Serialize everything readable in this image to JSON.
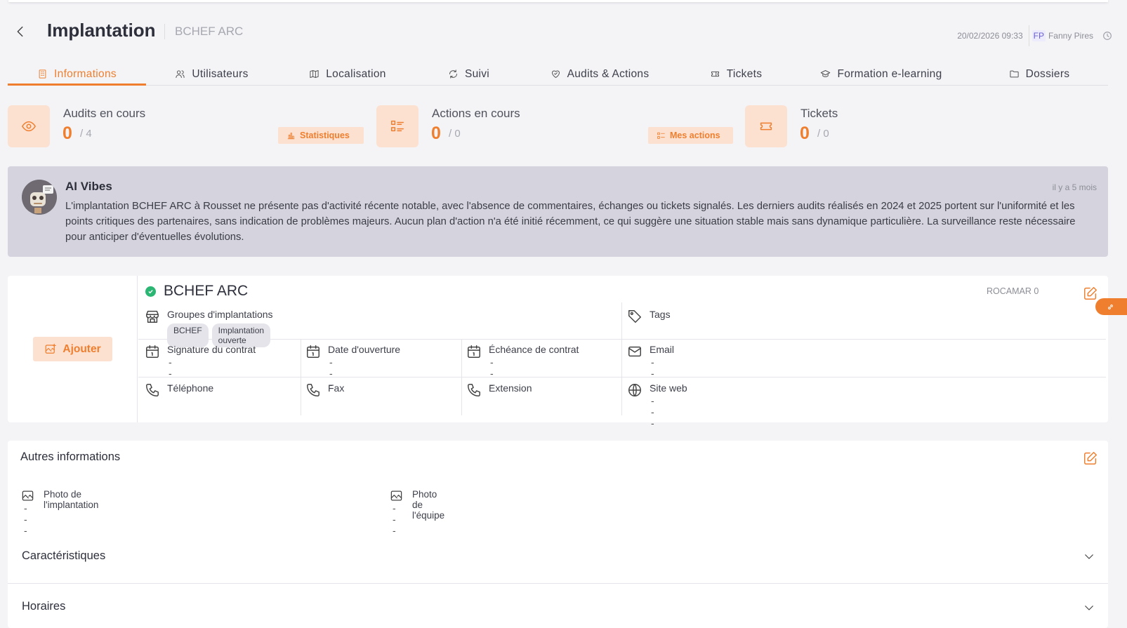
{
  "header": {
    "title": "Implantation",
    "subtitle": "BCHEF ARC",
    "datetime": "20/02/2026 09:33",
    "user_initials": "FP",
    "user_name": "Fanny Pires"
  },
  "tabs": [
    {
      "label": "Informations",
      "icon": "building-icon",
      "active": true
    },
    {
      "label": "Utilisateurs",
      "icon": "users-icon"
    },
    {
      "label": "Localisation",
      "icon": "map-icon"
    },
    {
      "label": "Suivi",
      "icon": "refresh-icon"
    },
    {
      "label": "Audits & Actions",
      "icon": "heart-check-icon"
    },
    {
      "label": "Tickets",
      "icon": "ticket-icon"
    },
    {
      "label": "Formation e-learning",
      "icon": "graduation-cap-icon"
    },
    {
      "label": "Dossiers",
      "icon": "folder-icon"
    }
  ],
  "stats": {
    "audits": {
      "label": "Audits en cours",
      "value": "0",
      "total": "/ 4",
      "button": "Statistiques"
    },
    "actions": {
      "label": "Actions en cours",
      "value": "0",
      "total": "/ 0",
      "button": "Mes actions"
    },
    "tickets": {
      "label": "Tickets",
      "value": "0",
      "total": "/ 0"
    }
  },
  "ai": {
    "title": "AI Vibes",
    "time": "il y a 5 mois",
    "text": "L'implantation BCHEF ARC à Rousset ne présente pas d'activité récente notable, avec l'absence de commentaires, échanges ou tickets signalés. Les derniers audits réalisés en 2024 et 2025 portent sur l'uniformité et les points critiques des partenaires, sans indication de problèmes majeurs. Aucun plan d'action n'a été initié récemment, ce qui suggère une situation stable mais sans dynamique particulière. La surveillance reste nécessaire pour anticiper d'éventuelles évolutions."
  },
  "card": {
    "add_label": "Ajouter",
    "name": "BCHEF ARC",
    "code": "ROCAMAR 0",
    "groups_label": "Groupes d'implantations",
    "groups": [
      "BCHEF",
      "Implantation ouverte"
    ],
    "tags_label": "Tags",
    "signature_label": "Signature du contrat",
    "signature_value": "---",
    "opening_label": "Date d'ouverture",
    "opening_value": "---",
    "deadline_label": "Échéance de contrat",
    "deadline_value": "---",
    "email_label": "Email",
    "email_value": "---",
    "phone_label": "Téléphone",
    "fax_label": "Fax",
    "extension_label": "Extension",
    "website_label": "Site web",
    "website_value": "---"
  },
  "other": {
    "title": "Autres informations",
    "photo_site_label": "Photo de l'implantation",
    "photo_site_value": "---",
    "photo_team_label": "Photo de l'équipe",
    "photo_team_value": "---",
    "characteristics": "Caractéristiques",
    "hours": "Horaires"
  },
  "colors": {
    "accent": "#ef7f2e",
    "accent_light": "#fce1d1",
    "ai_background": "#d5d4de",
    "status_ok": "#2bb673"
  }
}
